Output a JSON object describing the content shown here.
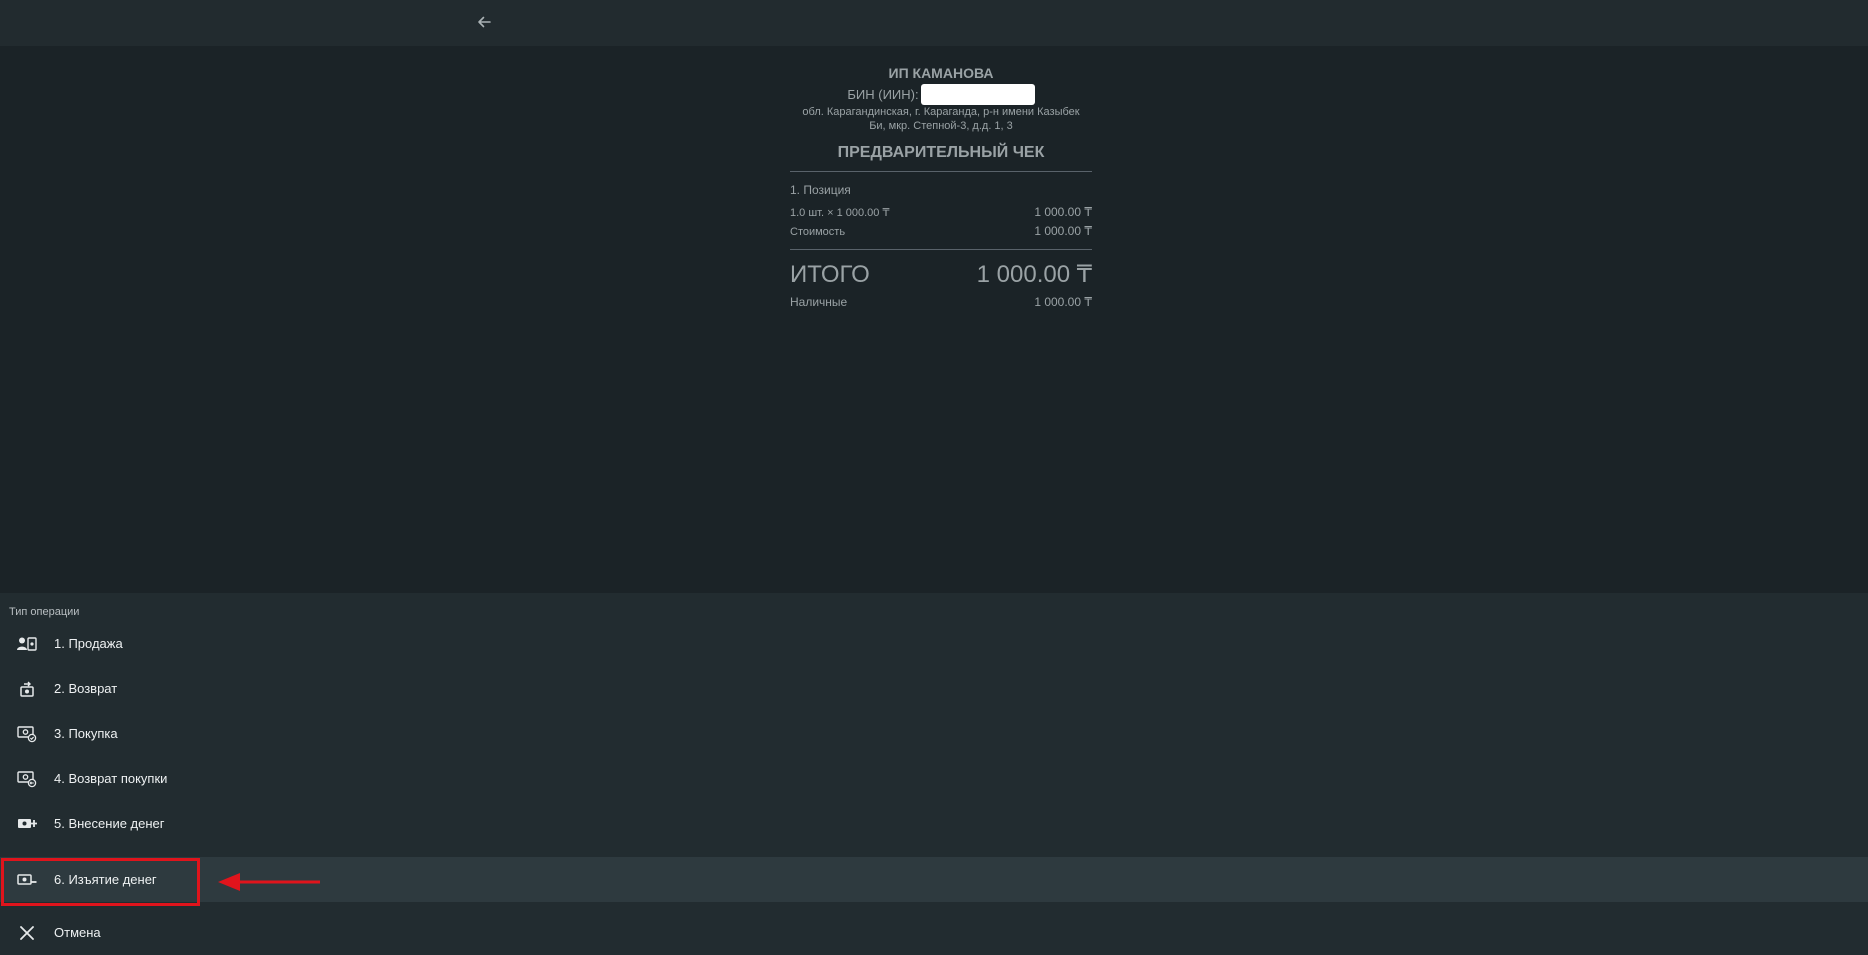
{
  "topbar": {
    "back_icon": "arrow-left-icon"
  },
  "receipt": {
    "company": "ИП КАМАНОВА",
    "bin_label": "БИН (ИИН):",
    "address_line1": "обл. Карагандинская, г. Караганда, р-н имени Казыбек",
    "address_line2": "Би, мкр. Степной-3, д.д. 1, 3",
    "title": "ПРЕДВАРИТЕЛЬНЫЙ ЧЕК",
    "position_name": "1. Позиция",
    "qty_price": "1.0 шт. × 1 000.00 ₸",
    "qty_price_total": "1 000.00 ₸",
    "cost_label": "Стоимость",
    "cost_value": "1 000.00 ₸",
    "total_label": "ИТОГО",
    "total_value": "1 000.00 ₸",
    "cash_label": "Наличные",
    "cash_value": "1 000.00 ₸"
  },
  "operations": {
    "header": "Тип операции",
    "items": [
      {
        "label": "1. Продажа",
        "icon": "sale-icon"
      },
      {
        "label": "2. Возврат",
        "icon": "return-icon"
      },
      {
        "label": "3. Покупка",
        "icon": "purchase-icon"
      },
      {
        "label": "4. Возврат покупки",
        "icon": "purchase-return-icon"
      },
      {
        "label": "5. Внесение денег",
        "icon": "cash-in-icon"
      },
      {
        "label": "6. Изъятие денег",
        "icon": "cash-out-icon",
        "selected": true
      }
    ],
    "cancel": {
      "label": "Отмена",
      "icon": "close-icon"
    }
  },
  "colors": {
    "background": "#1b2327",
    "panel": "#222c30",
    "selected_row": "#2e3a3f",
    "annotation_red": "#e0141c"
  }
}
